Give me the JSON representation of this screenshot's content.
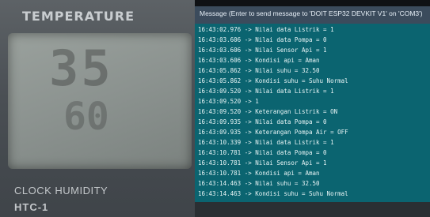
{
  "device": {
    "header": "TEMPERATURE",
    "footer": "CLOCK HUMIDITY",
    "model": "HTC-1"
  },
  "serial_monitor": {
    "title": "Message (Enter to send message to 'DOIT ESP32 DEVKIT V1' on 'COM3')",
    "lines": [
      "16:43:02.976 -> Nilai data Listrik = 1",
      "16:43:03.606 -> Nilai data Pompa = 0",
      "16:43:03.606 -> Nilai Sensor Api = 1",
      "16:43:03.606 -> Kondisi api = Aman",
      "16:43:05.862 -> Nilai suhu = 32.50",
      "16:43:05.862 -> Kondisi suhu = Suhu Normal",
      "16:43:09.520 -> Nilai data Listrik = 1",
      "16:43:09.520 -> 1",
      "16:43:09.520 -> Keterangan Listrik = ON",
      "16:43:09.935 -> Nilai data Pompa = 0",
      "16:43:09.935 -> Keterangan Pompa Air = OFF",
      "16:43:10.339 -> Nilai data Listrik = 1",
      "16:43:10.781 -> Nilai data Pompa = 0",
      "16:43:10.781 -> Nilai Sensor Api = 1",
      "16:43:10.781 -> Kondisi api = Aman",
      "16:43:14.463 -> Nilai suhu = 32.50",
      "16:43:14.463 -> Kondisi suhu = Suhu Normal"
    ]
  }
}
